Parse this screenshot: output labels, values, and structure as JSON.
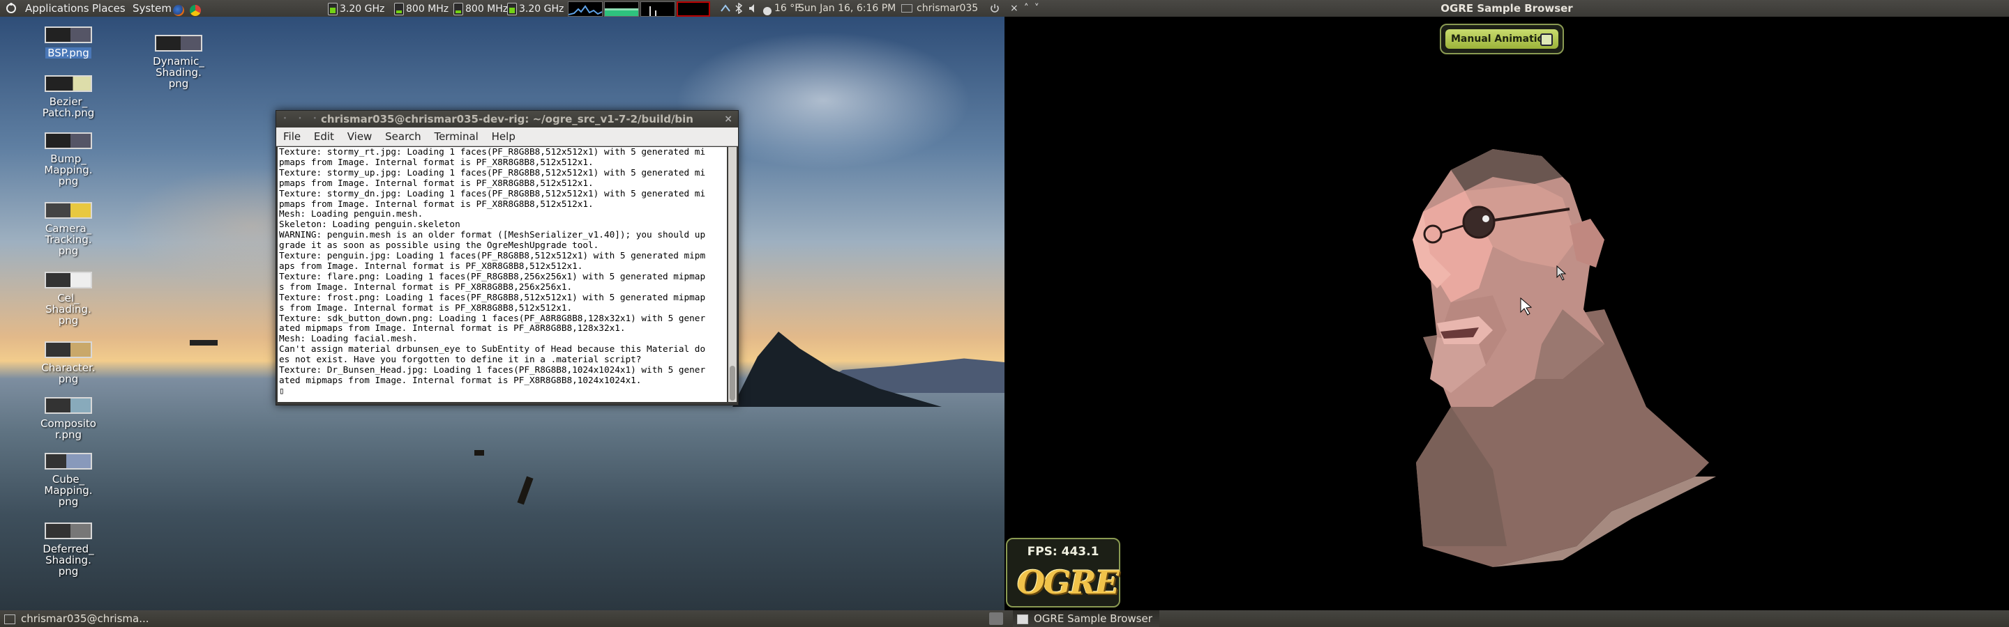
{
  "top_panel": {
    "menus": [
      "Applications",
      "Places",
      "System"
    ],
    "cpus": [
      "3.20 GHz",
      "800 MHz",
      "800 MHz",
      "3.20 GHz"
    ],
    "weather": "16 °F",
    "datetime": "Sun Jan 16,  6:16 PM",
    "user": "chrismar035"
  },
  "desktop": {
    "icons": [
      {
        "label": "BSP.png",
        "selected": true
      },
      {
        "label": "Dynamic_\nShading.\npng"
      },
      {
        "label": "Bezier_\nPatch.png"
      },
      {
        "label": "Bump_\nMapping.\npng"
      },
      {
        "label": "Camera_\nTracking.\npng"
      },
      {
        "label": "Cel_\nShading.\npng"
      },
      {
        "label": "Character.\npng"
      },
      {
        "label": "Composito\nr.png"
      },
      {
        "label": "Cube_\nMapping.\npng"
      },
      {
        "label": "Deferred_\nShading.\npng"
      }
    ]
  },
  "terminal": {
    "title": "chrismar035@chrismar035-dev-rig: ~/ogre_src_v1-7-2/build/bin",
    "menu": [
      "File",
      "Edit",
      "View",
      "Search",
      "Terminal",
      "Help"
    ],
    "lines": [
      "Texture: stormy_rt.jpg: Loading 1 faces(PF_R8G8B8,512x512x1) with 5 generated mi",
      "pmaps from Image. Internal format is PF_X8R8G8B8,512x512x1.",
      "Texture: stormy_up.jpg: Loading 1 faces(PF_R8G8B8,512x512x1) with 5 generated mi",
      "pmaps from Image. Internal format is PF_X8R8G8B8,512x512x1.",
      "Texture: stormy_dn.jpg: Loading 1 faces(PF_R8G8B8,512x512x1) with 5 generated mi",
      "pmaps from Image. Internal format is PF_X8R8G8B8,512x512x1.",
      "Mesh: Loading penguin.mesh.",
      "Skeleton: Loading penguin.skeleton",
      "WARNING: penguin.mesh is an older format ([MeshSerializer_v1.40]); you should up",
      "grade it as soon as possible using the OgreMeshUpgrade tool.",
      "Texture: penguin.jpg: Loading 1 faces(PF_R8G8B8,512x512x1) with 5 generated mipm",
      "aps from Image. Internal format is PF_X8R8G8B8,512x512x1.",
      "Texture: flare.png: Loading 1 faces(PF_R8G8B8,256x256x1) with 5 generated mipmap",
      "s from Image. Internal format is PF_X8R8G8B8,256x256x1.",
      "Texture: frost.png: Loading 1 faces(PF_R8G8B8,512x512x1) with 5 generated mipmap",
      "s from Image. Internal format is PF_X8R8G8B8,512x512x1.",
      "Texture: sdk_button_down.png: Loading 1 faces(PF_A8R8G8B8,128x32x1) with 5 gener",
      "ated mipmaps from Image. Internal format is PF_A8R8G8B8,128x32x1.",
      "Mesh: Loading facial.mesh.",
      "Can't assign material drbunsen_eye to SubEntity of Head because this Material do",
      "es not exist. Have you forgotten to define it in a .material script?",
      "Texture: Dr_Bunsen_Head.jpg: Loading 1 faces(PF_R8G8B8,1024x1024x1) with 5 gener",
      "ated mipmaps from Image. Internal format is PF_X8R8G8B8,1024x1024x1.",
      "▯"
    ]
  },
  "ogre": {
    "window_title": "OGRE Sample Browser",
    "manual_animation_label": "Manual Animation",
    "manual_animation_checked": false,
    "fps_label": "FPS: 443.1",
    "logo_text": "OGRE"
  },
  "bottom_panel": {
    "tasks": [
      "chrismar035@chrisma...",
      "OGRE Sample Browser"
    ]
  },
  "colors": {
    "panel": "#3a3935",
    "ogre_accent": "#9cb33a",
    "logo": "#f1c34a"
  }
}
